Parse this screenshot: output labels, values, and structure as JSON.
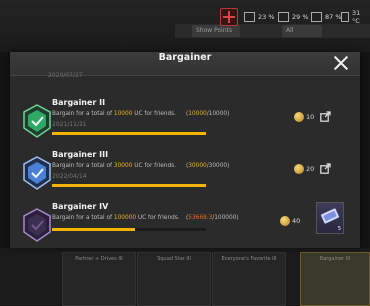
{
  "status_bar": {
    "wifi": "23 %",
    "signal": "29 %",
    "battery": "87 %",
    "temperature": "31 °C"
  },
  "background": {
    "tabs": [
      "Show Points",
      "All",
      "",
      ""
    ],
    "cards": [
      "Partner + Drives III",
      "Squad Star III",
      "Everyone's Favorite III",
      "",
      "Bargainer III"
    ]
  },
  "modal": {
    "title": "Bargainer",
    "partial_date": "2020/07/27",
    "rows": [
      {
        "title": "Bargainer II",
        "desc_prefix": "Bargain for a total of",
        "amount": "10000",
        "desc_suffix": "UC for friends.",
        "progress_current": "10000",
        "progress_total": "/10000",
        "date": "2021/11/21",
        "progress_fraction": 1.0,
        "points": "10",
        "badge_color": "#2fa866"
      },
      {
        "title": "Bargainer III",
        "desc_prefix": "Bargain for a total of",
        "amount": "30000",
        "desc_suffix": "UC for friends.",
        "progress_current": "30000",
        "progress_total": "/30000",
        "date": "2022/04/14",
        "progress_fraction": 1.0,
        "points": "20",
        "badge_color": "#4a7fd6"
      },
      {
        "title": "Bargainer IV",
        "desc_prefix": "Bargain for a total of",
        "amount": "100000",
        "desc_suffix": "UC for friends.",
        "progress_current": "53669.3",
        "progress_total": "/100000",
        "date": "",
        "progress_fraction": 0.54,
        "points": "40",
        "reward_count": "5",
        "badge_color": "#7a4ea8"
      }
    ]
  }
}
